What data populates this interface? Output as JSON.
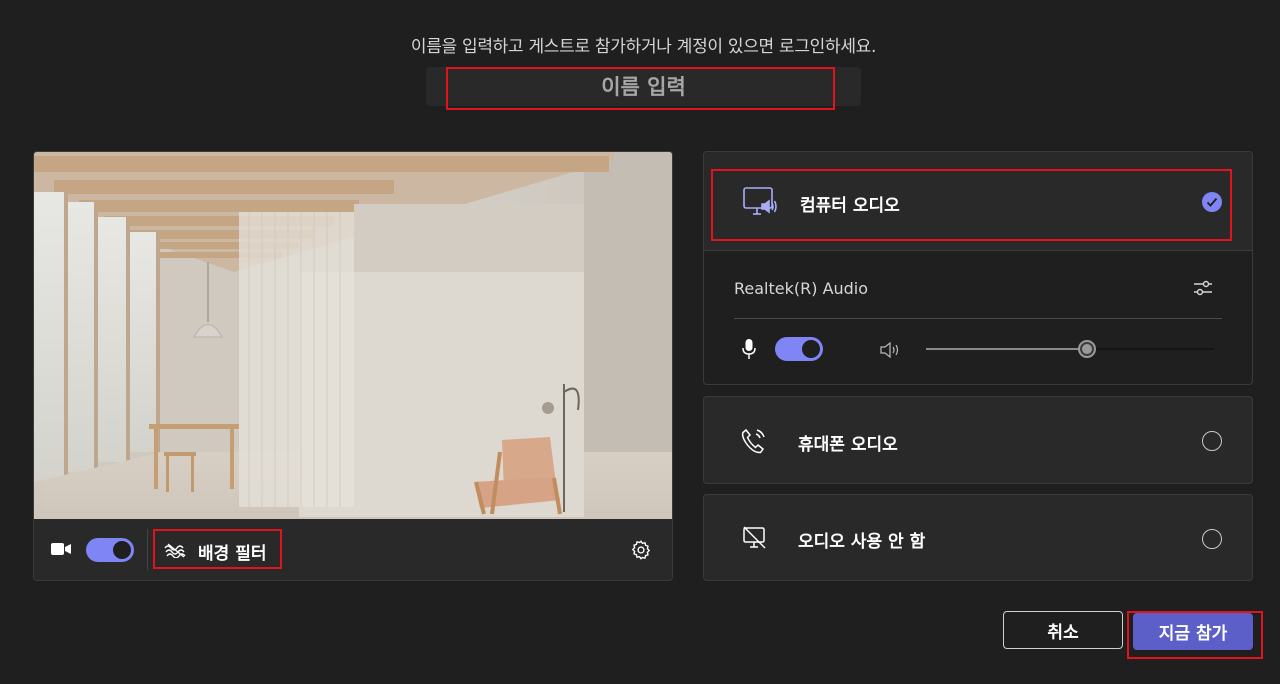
{
  "instruction": "이름을 입력하고 게스트로 참가하거나 계정이 있으면 로그인하세요.",
  "name_input": {
    "placeholder": "이름 입력",
    "value": ""
  },
  "video": {
    "camera_on": true,
    "background_filter_label": "배경 필터",
    "icons": {
      "camera": "video-camera-icon",
      "filter": "background-filter-icon",
      "settings": "gear-icon"
    }
  },
  "audio": {
    "computer": {
      "label": "컴퓨터 오디오",
      "selected": true,
      "device_name": "Realtek(R) Audio",
      "mic_on": true,
      "speaker_volume": 0.56
    },
    "phone": {
      "label": "휴대폰 오디오",
      "selected": false
    },
    "none": {
      "label": "오디오 사용 안 함",
      "selected": false
    }
  },
  "buttons": {
    "cancel": "취소",
    "join": "지금 참가"
  },
  "colors": {
    "accent": "#7f85f5",
    "primary_button": "#5b5fc7",
    "highlight": "#e0141c",
    "background": "#1f1f1f"
  }
}
